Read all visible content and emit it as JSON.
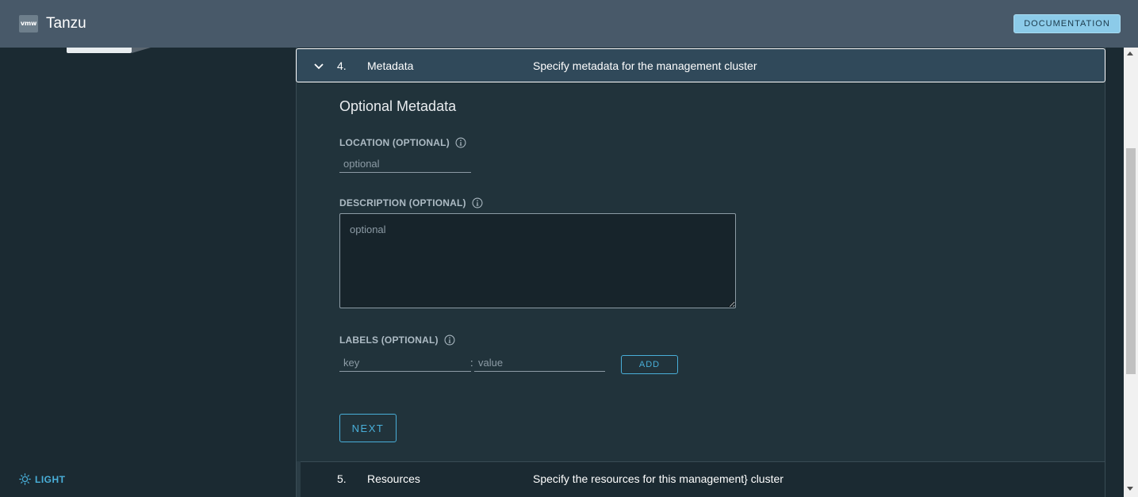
{
  "header": {
    "logo_text": "vmw",
    "title": "Tanzu",
    "documentation_label": "DOCUMENTATION"
  },
  "sidebar": {
    "theme_label": "LIGHT"
  },
  "steps": {
    "current": {
      "number": "4.",
      "title": "Metadata",
      "description": "Specify metadata for the management cluster"
    },
    "next": {
      "number": "5.",
      "title": "Resources",
      "description": "Specify the resources for this management} cluster"
    }
  },
  "form": {
    "section_title": "Optional Metadata",
    "location": {
      "label": "LOCATION (OPTIONAL)",
      "placeholder": "optional",
      "value": ""
    },
    "description": {
      "label": "DESCRIPTION (OPTIONAL)",
      "placeholder": "optional",
      "value": ""
    },
    "labels": {
      "label": "LABELS (OPTIONAL)",
      "key_placeholder": "key",
      "value_placeholder": "value",
      "separator": ":",
      "add_label": "ADD"
    },
    "next_label": "NEXT"
  }
}
